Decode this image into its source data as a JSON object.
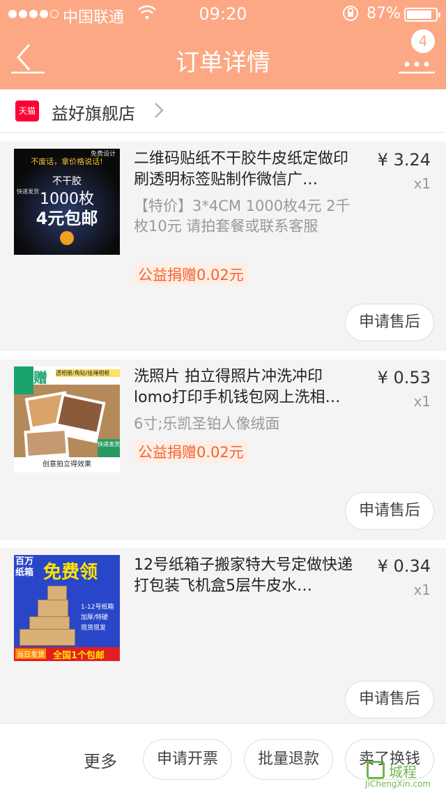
{
  "status_bar": {
    "carrier": "中国联通",
    "time": "09:20",
    "battery": "87%",
    "battery_level": 0.87
  },
  "nav": {
    "title": "订单详情",
    "badge_count": "4"
  },
  "shop": {
    "platform_icon": "天猫",
    "name": "益好旗舰店"
  },
  "items": [
    {
      "title": "二维码贴纸不干胶牛皮纸定做印刷透明标签贴制作微信广…",
      "spec": "【特价】3*4CM  1000枚4元 2千枚10元 请拍套餐或联系客服",
      "donation": "公益捐赠0.02元",
      "price": "¥ 3.24",
      "qty": "x1",
      "after_sale": "申请售后",
      "thumb_text": {
        "line1": "不废话，拿价格说话!",
        "line2": "不干胶",
        "line3": "1000枚",
        "line4": "4元包邮",
        "tag_left": "快递发货",
        "tag_right": "免费设计"
      }
    },
    {
      "title": "洗照片 拍立得照片冲洗冲印lomo打印手机钱包网上洗相…",
      "spec": "6寸;乐凯圣铂人像绒面",
      "donation": "公益捐赠0.02元",
      "price": "¥ 0.53",
      "qty": "x1",
      "after_sale": "申请售后",
      "thumb_text": {
        "gift": "赠",
        "tag": "透相册/角贴/挂绳相框",
        "express": "快递发货",
        "bottom": "创意拍立得效果"
      }
    },
    {
      "title": "12号纸箱子搬家特大号定做快递打包装飞机盒5层牛皮水…",
      "price": "¥ 0.34",
      "qty": "x1",
      "after_sale": "申请售后",
      "thumb_text": {
        "top_left": "百万纸箱",
        "top_right": "免费领",
        "list1": "1-12号纸箱",
        "list2": "加厚/特硬",
        "list3": "现货现发",
        "bottom_left": "当日发货",
        "bottom_right": "全国1个包邮"
      }
    }
  ],
  "bottom_bar": {
    "more": "更多",
    "invoice": "申请开票",
    "batch_refund": "批量退款",
    "sell_swap": "卖了换钱"
  },
  "watermark": {
    "brand": "城程",
    "url": "JiChengXin.com"
  },
  "colors": {
    "header": "#fca884",
    "donation": "#f5622a",
    "tmall": "#ff0036"
  }
}
